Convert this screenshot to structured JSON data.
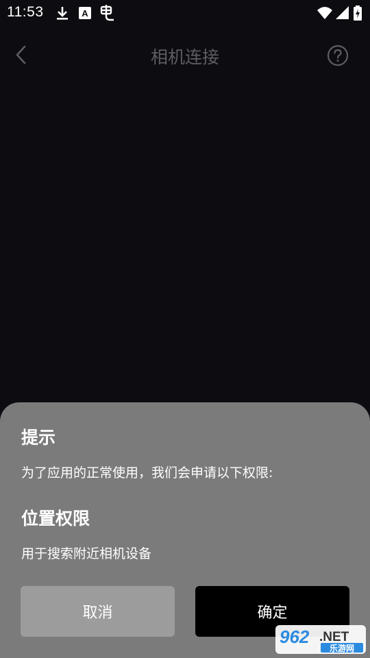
{
  "status_bar": {
    "time": "11:53",
    "icons": [
      "download-icon",
      "a-box-icon",
      "bug-icon",
      "wifi-icon",
      "signal-icon",
      "battery-icon"
    ]
  },
  "header": {
    "title": "相机连接",
    "back_icon": "chevron-left-icon",
    "help_icon": "question-circle-icon"
  },
  "dialog": {
    "title": "提示",
    "description": "为了应用的正常使用，我们会申请以下权限:",
    "permission": {
      "title": "位置权限",
      "description": "用于搜索附近相机设备"
    },
    "cancel_label": "取消",
    "confirm_label": "确定"
  },
  "watermark": {
    "brand_number": "962",
    "brand_suffix": ".NET",
    "brand_sub": "乐游网"
  },
  "colors": {
    "background": "#0d0c10",
    "sheet": "#7b7b7b",
    "cancel_button": "#9c9c9c",
    "confirm_button": "#000000",
    "title_text": "#5e5e62"
  }
}
